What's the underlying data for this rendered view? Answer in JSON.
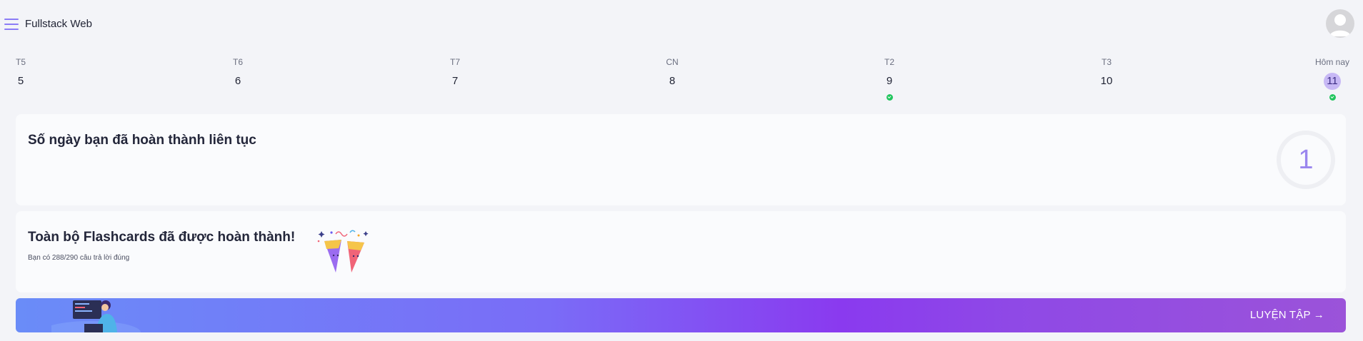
{
  "header": {
    "title": "Fullstack Web",
    "menu_icon": "hamburger-menu-icon",
    "avatar_icon": "user-avatar-icon"
  },
  "week": {
    "days": [
      {
        "label": "T5",
        "num": "5",
        "done": false,
        "today": false
      },
      {
        "label": "T6",
        "num": "6",
        "done": false,
        "today": false
      },
      {
        "label": "T7",
        "num": "7",
        "done": false,
        "today": false
      },
      {
        "label": "CN",
        "num": "8",
        "done": false,
        "today": false
      },
      {
        "label": "T2",
        "num": "9",
        "done": true,
        "today": false
      },
      {
        "label": "T3",
        "num": "10",
        "done": false,
        "today": false
      },
      {
        "label": "Hôm nay",
        "num": "11",
        "done": true,
        "today": true
      }
    ]
  },
  "streak": {
    "title": "Số ngày bạn đã hoàn thành liên tục",
    "count": "1"
  },
  "flashcards": {
    "title": "Toàn bộ Flashcards đã được hoàn thành!",
    "subtitle": "Bạn có 288/290 câu trả lời đúng"
  },
  "practice": {
    "label": "LUYỆN TẬP →"
  },
  "colors": {
    "accent": "#8b7cf6",
    "done_dot": "#22c55e",
    "today_bg": "#c7b8f5"
  }
}
